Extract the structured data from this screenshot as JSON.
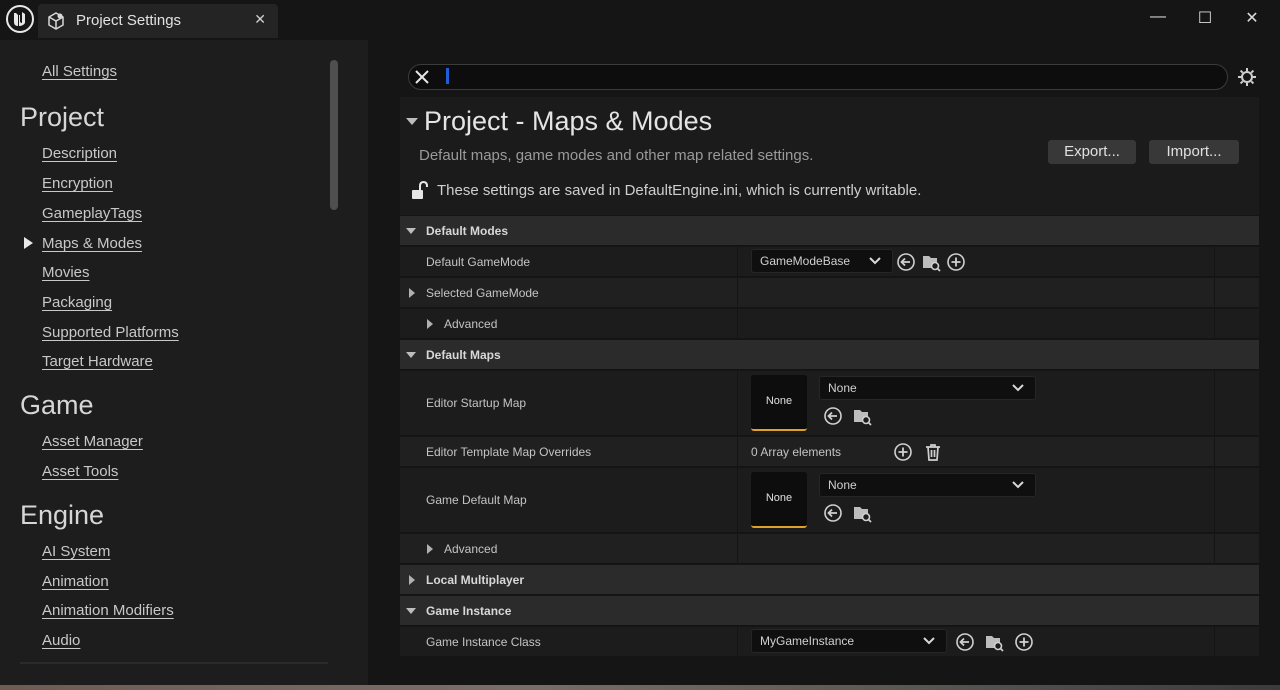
{
  "window": {
    "tab_title": "Project Settings",
    "tab_close": "✕",
    "min_glyph": "—",
    "max_glyph": "☐",
    "close_glyph": "✕"
  },
  "sidebar": {
    "all_settings": "All Settings",
    "sections": [
      {
        "heading": "Project",
        "items": [
          "Description",
          "Encryption",
          "GameplayTags",
          "Maps & Modes",
          "Movies",
          "Packaging",
          "Supported Platforms",
          "Target Hardware"
        ]
      },
      {
        "heading": "Game",
        "items": [
          "Asset Manager",
          "Asset Tools"
        ]
      },
      {
        "heading": "Engine",
        "items": [
          "AI System",
          "Animation",
          "Animation Modifiers",
          "Audio"
        ]
      }
    ],
    "selected_item": "Maps & Modes"
  },
  "search": {
    "value": "",
    "placeholder": ""
  },
  "header": {
    "title": "Project - Maps & Modes",
    "subtitle": "Default maps, game modes and other map related settings.",
    "export_label": "Export...",
    "import_label": "Import...",
    "writable_note": "These settings are saved in DefaultEngine.ini, which is currently writable."
  },
  "categories": {
    "default_modes": "Default Modes",
    "default_maps": "Default Maps",
    "local_multiplayer": "Local Multiplayer",
    "game_instance": "Game Instance"
  },
  "properties": {
    "default_gamemode": {
      "label": "Default GameMode",
      "value": "GameModeBase"
    },
    "selected_gamemode": {
      "label": "Selected GameMode"
    },
    "advanced_1": {
      "label": "Advanced"
    },
    "editor_startup_map": {
      "label": "Editor Startup Map",
      "value": "None",
      "thumb": "None"
    },
    "editor_template_overrides": {
      "label": "Editor Template Map Overrides",
      "value": "0 Array elements"
    },
    "game_default_map": {
      "label": "Game Default Map",
      "value": "None",
      "thumb": "None"
    },
    "advanced_2": {
      "label": "Advanced"
    },
    "game_instance_class": {
      "label": "Game Instance Class",
      "value": "MyGameInstance"
    }
  },
  "colors": {
    "accent_orange": "#e0a12a",
    "caret_blue": "#1f5fd6",
    "background": "#151515"
  },
  "icons": [
    "ue-logo-icon",
    "settings-cube-icon",
    "close-icon",
    "gear-icon",
    "lock-open-icon",
    "chevron-down-icon",
    "reset-arrow-icon",
    "browse-folder-icon",
    "add-circle-icon",
    "trash-icon"
  ]
}
